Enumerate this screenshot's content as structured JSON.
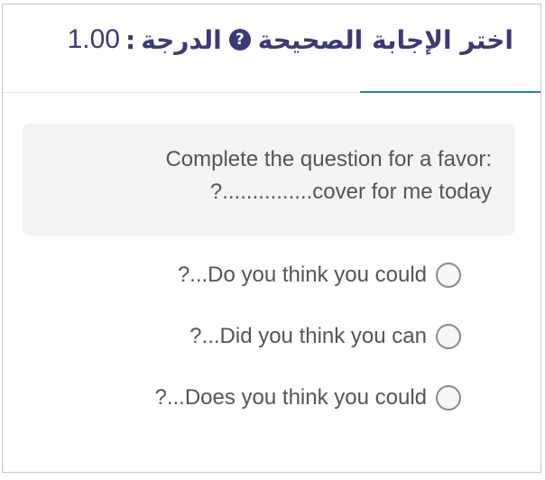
{
  "header": {
    "instruction": "اختر الإجابة الصحيحة",
    "help_glyph": "?",
    "grade_label": "الدرجة",
    "grade_separator": ":",
    "grade_value": "1.00"
  },
  "question": {
    "line1": "Complete the question for a favor:",
    "line2": "?...............cover for me today"
  },
  "options": [
    {
      "label": "?...Do you think you could",
      "selected": false
    },
    {
      "label": "?...Did you think you can",
      "selected": false
    },
    {
      "label": "?...Does you think you could",
      "selected": false
    }
  ],
  "colors": {
    "title": "#3c3a76",
    "accent": "#1f8a8a",
    "question_bg": "#f4f4f4"
  }
}
